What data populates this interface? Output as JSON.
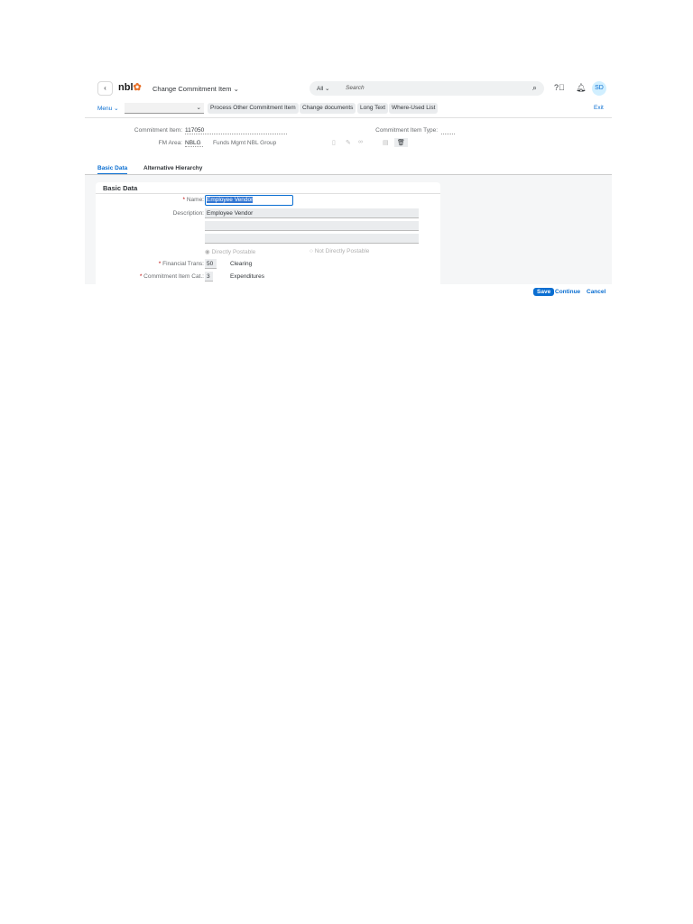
{
  "shell": {
    "logo": "nbl",
    "title": "Change Commitment Item",
    "search_scope": "All",
    "search_placeholder": "Search",
    "avatar": "SD"
  },
  "toolbar": {
    "menu": "Menu",
    "buttons": [
      "Process Other Commitment Item",
      "Change documents",
      "Long Text",
      "Where-Used List"
    ],
    "exit": "Exit"
  },
  "header": {
    "commitment_item_label": "Commitment Item:",
    "commitment_item": "117050",
    "fm_area_label": "FM Area:",
    "fm_area": "NBLG",
    "fm_area_text": "Funds Mgmt NBL Group",
    "type_label": "Commitment Item Type:"
  },
  "tabs": [
    "Basic Data",
    "Alternative Hierarchy"
  ],
  "basic": {
    "section": "Basic Data",
    "name_label": "Name:",
    "name": "Employee Vendor",
    "desc_label": "Description:",
    "desc": "Employee Vendor",
    "radio1": "Directly Postable",
    "radio2": "Not Directly Postable",
    "fin_label": "Financial Trans:",
    "fin": "50",
    "fin_text": "Clearing",
    "cat_label": "Commitment Item Cat.:",
    "cat": "3",
    "cat_text": "Expenditures"
  },
  "footer": {
    "save": "Save",
    "continue": "Continue",
    "cancel": "Cancel"
  }
}
